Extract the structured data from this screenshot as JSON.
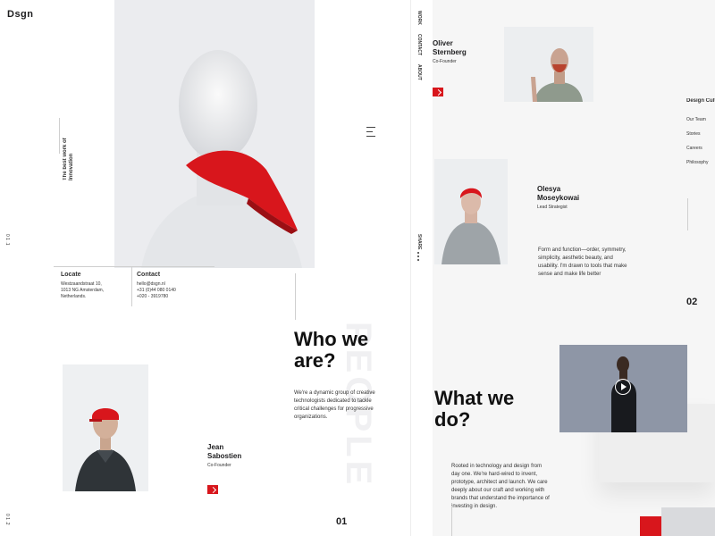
{
  "brand": {
    "logo": "Dsgn"
  },
  "left": {
    "tagline": "The best work of Innovation",
    "page_marker_top": "0 1 .1",
    "page_marker_bottom": "0 1 .2",
    "locate": {
      "heading": "Locate",
      "lines": [
        "Westzaandstraat 10,",
        "1013 NG Amsterdam,",
        "Netherlands."
      ]
    },
    "contact": {
      "heading": "Contact",
      "lines": [
        "hello@dsgn.nl",
        "+31 (0)44 080 0140",
        "+020 - 3919780"
      ]
    },
    "who": {
      "title_line1": "Who we",
      "title_line2": "are?",
      "watermark": "PEOPLE",
      "text": "We're a dynamic group of creative technologists dedicated to tackle critical challenges for progressive organizations.",
      "page_number": "01"
    },
    "member": {
      "name_line1": "Jean",
      "name_line2": "Sabostien",
      "role": "Co-Founder"
    }
  },
  "nav": {
    "items": [
      "WORK",
      "CONTACT",
      "ABOUT"
    ],
    "share": "SHARE"
  },
  "right": {
    "member1": {
      "name_line1": "Oliver",
      "name_line2": "Sternberg",
      "role": "Co-Founder"
    },
    "member2": {
      "name_line1": "Olesya",
      "name_line2": "Moseykowai",
      "role": "Lead Strategist"
    },
    "quote": "Form and function—order, symmetry, simplicity, aesthetic beauty, and usability. I'm drawn to tools that make sense and make life better",
    "side_menu": {
      "title": "Design Cultu",
      "items": [
        "Our Team",
        "Stories",
        "Careers",
        "Philosophy"
      ]
    },
    "page_number": "02",
    "what": {
      "title_line1": "What we",
      "title_line2": "do?",
      "text": "Rooted in technology and design from day one. We're hard-wired to invent, prototype, architect and launch. We care deeply about our craft and working with brands that understand the importance of investing in design."
    }
  },
  "colors": {
    "accent": "#d8161c",
    "text": "#1d1d1f",
    "panel": "#ebecef"
  }
}
